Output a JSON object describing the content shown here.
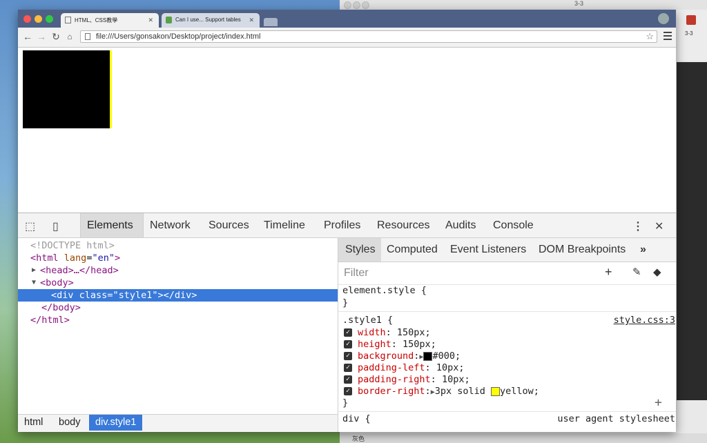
{
  "background_window": {
    "title": "3-3",
    "right_label": "3-3",
    "bottom_label": "灰色"
  },
  "browser": {
    "tabs": [
      {
        "label": "HTML、CSS教學"
      },
      {
        "label": "Can I use... Support tables"
      }
    ],
    "url": "file:///Users/gonsakon/Desktop/project/index.html"
  },
  "devtools": {
    "tabs": [
      "Elements",
      "Network",
      "Sources",
      "Timeline",
      "Profiles",
      "Resources",
      "Audits",
      "Console"
    ],
    "elements": {
      "doctype": "<!DOCTYPE html>",
      "html_open_tag": "html",
      "html_attr": "lang",
      "html_attr_val": "\"en\"",
      "head": "<head>…</head>",
      "body_open": "<body>",
      "div_tag": "div",
      "div_attr": "class",
      "div_attr_val": "\"style1\"",
      "div_close": "></div>",
      "body_close": "</body>",
      "html_close": "</html>"
    },
    "breadcrumbs": [
      "html",
      "body",
      "div.style1"
    ],
    "styles": {
      "tabs": [
        "Styles",
        "Computed",
        "Event Listeners",
        "DOM Breakpoints"
      ],
      "more": "»",
      "filter_placeholder": "Filter",
      "element_style": "element.style {",
      "close_brace": "}",
      "rule_selector": ".style1 {",
      "rule_source": "style.css:3",
      "properties": [
        {
          "name": "width",
          "value": "150px;"
        },
        {
          "name": "height",
          "value": "150px;"
        },
        {
          "name": "background",
          "value": "#000;",
          "swatch": "#000000"
        },
        {
          "name": "padding-left",
          "value": "10px;"
        },
        {
          "name": "padding-right",
          "value": "10px;"
        },
        {
          "name": "border-right",
          "value": "3px solid",
          "swatch": "#ffff00",
          "value2": "yellow;"
        }
      ],
      "next_selector": "div {",
      "next_source": "user agent stylesheet"
    }
  }
}
